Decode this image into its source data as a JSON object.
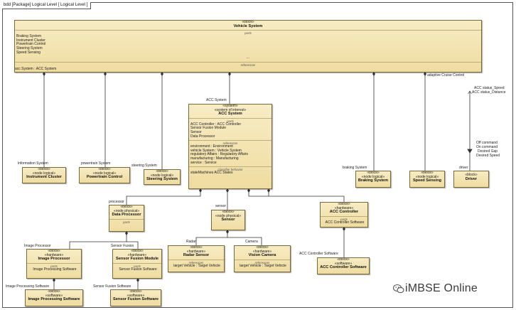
{
  "frame": {
    "title": "bdd [Package] Logical Level [ Logical Level ]"
  },
  "vehicle_system": {
    "stereotype": "«block»",
    "name": "Vehicle System",
    "section": "parts",
    "parts": [
      "Braking System",
      "Instrument Cluster",
      "Powertrain Control",
      "Steering System",
      "Speed Sensing"
    ],
    "ellipsis": "...",
    "references": "references",
    "bottom_label": "acc System : ACC System",
    "right_label": "adaptive Cruise Control"
  },
  "acc_system": {
    "role": "ACC System",
    "stereotype1": "«system»",
    "stereotype2": "«system of interest»",
    "name": "ACC System",
    "parts_title": "parts",
    "parts": [
      "ACC Controller : ACC Controller",
      "Sensor Fusion Module",
      "Sensor",
      "Data Processor"
    ],
    "refs_title": "references",
    "refs": [
      "environment : Environment",
      "vehicle System : Vehicle System",
      "regulatory Affairs : Regulatory Affairs",
      "manufacturing : Manufacturing",
      "service : Service"
    ],
    "sm_title": "classifier behavior",
    "sm": "stateMachines ACC States"
  },
  "blocks": [
    {
      "id": "instrument-cluster",
      "role": "information System",
      "st1": "«block»",
      "st2": "«node logical»",
      "name": "Instrument Cluster"
    },
    {
      "id": "powertrain-control",
      "role": "powertrain System",
      "st1": "«block»",
      "st2": "«node logical»",
      "name": "Powertrain Control"
    },
    {
      "id": "steering-system",
      "role": "steering System",
      "st1": "«block»",
      "st2": "«node logical»",
      "name": "Steering System"
    },
    {
      "id": "braking-system",
      "role": "braking System",
      "st1": "«block»",
      "st2": "«node logical»",
      "name": "Braking System"
    },
    {
      "id": "speed-sensing",
      "role": "",
      "st1": "«block»",
      "st2": "«node logical»",
      "name": "Speed Sensing"
    },
    {
      "id": "driver",
      "role": "driver",
      "st1": "«block»",
      "st2": "",
      "name": "Driver"
    }
  ],
  "driver_flow": {
    "up": [
      "ACC status_Speed",
      "ACC status_Distance"
    ],
    "down": [
      "Off command",
      "On command",
      "Desired Gap",
      "Desired Speed"
    ]
  },
  "data_processor": {
    "role": "processor",
    "st1": "«block»",
    "st2": "«node physical»",
    "name": "Data Processor",
    "section": "parts"
  },
  "sensor": {
    "role": "sensor",
    "st1": "«block»",
    "st2": "«node physical»",
    "name": "Sensor"
  },
  "acc_controller": {
    "st1": "«block»",
    "st2": "«hardware»",
    "name": "ACC Controller",
    "section": "parts",
    "part": "ACC Controller Software"
  },
  "image_processor": {
    "role": "Image Processor",
    "st1": "«block»",
    "st2": "«hardware»",
    "name": "Image Processor",
    "section": "parts",
    "part": "Image Processing Software"
  },
  "sensor_fusion": {
    "role": "Sensor Fusion",
    "st1": "«block»",
    "st2": "«hardware»",
    "name": "Sensor Fusion Module",
    "section": "parts",
    "part": "Sensor Fusion Software"
  },
  "radar_sensor": {
    "role": "Radar",
    "st1": "«block»",
    "st2": "«hardware»",
    "name": "Radar Sensor",
    "section": "references",
    "ref": "target Vehicle : Target Vehicle"
  },
  "vision_camera": {
    "role": "Camera",
    "st1": "«block»",
    "st2": "«hardware»",
    "name": "Vision Camera",
    "section": "references",
    "ref": "target Vehicle : Target Vehicle"
  },
  "acc_software": {
    "role": "ACC Controller Software",
    "st1": "«block»",
    "st2": "«software»",
    "name": "ACC Controller Software"
  },
  "img_software": {
    "role": "Image Processing Software",
    "st1": "«block»",
    "st2": "«software»",
    "name": "Image Processing Software"
  },
  "fusion_software": {
    "role": "Sensor Fusion Software",
    "st1": "«block»",
    "st2": "«software»",
    "name": "Sensor Fusion Software"
  },
  "watermark": {
    "text": "iMBSE Online"
  }
}
